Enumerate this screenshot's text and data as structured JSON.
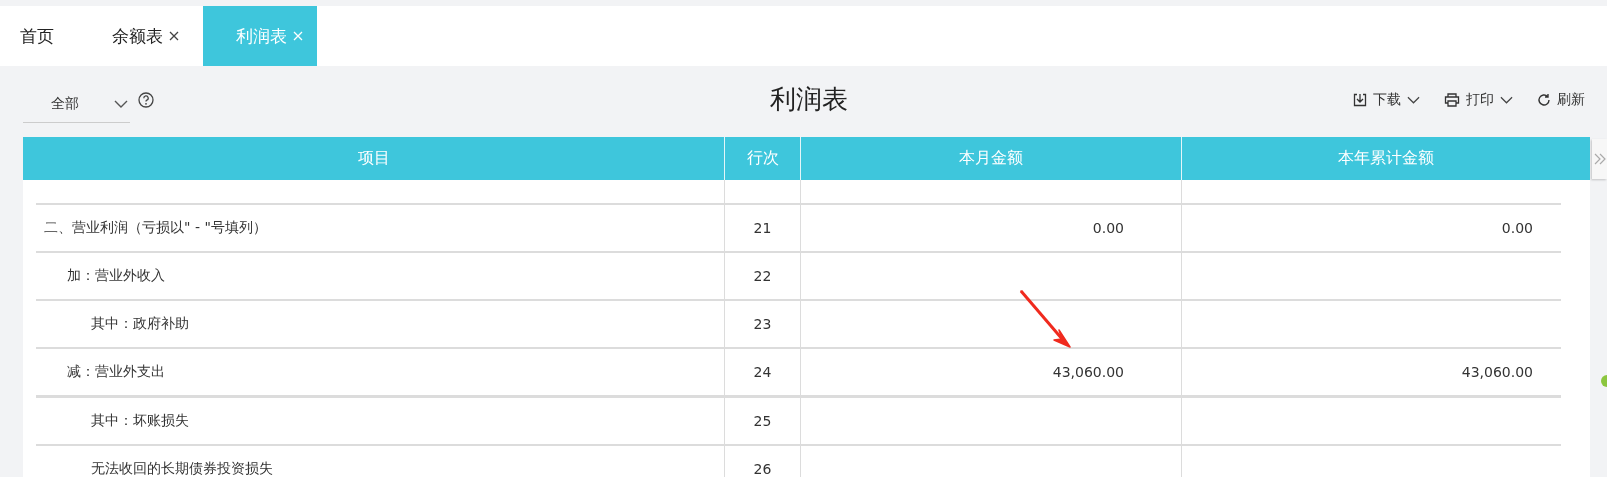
{
  "tabs": [
    {
      "label": "首页",
      "closable": false,
      "selected": false
    },
    {
      "label": "余额表",
      "closable": true,
      "selected": false
    },
    {
      "label": "利润表",
      "closable": true,
      "selected": true
    }
  ],
  "filter": {
    "value": "全部"
  },
  "title": "利润表",
  "toolbar": [
    {
      "label": "下载",
      "kind": "download"
    },
    {
      "label": "打印",
      "kind": "print"
    },
    {
      "label": "刷新",
      "kind": "refresh"
    }
  ],
  "table": {
    "columns": [
      "项目",
      "行次",
      "本月金额",
      "本年累计金额"
    ],
    "rows": [
      {
        "thick_rule": false
      },
      {
        "item": "二、营业利润（亏损以\" - \"号填列）",
        "line": "21",
        "month": "0.00",
        "year": "0.00",
        "kind": "heading",
        "thick_rule": false
      },
      {
        "item": "加：营业外收入",
        "line": "22",
        "month": "",
        "year": "",
        "kind": "item",
        "thick_rule": false
      },
      {
        "item": "其中：政府补助",
        "line": "23",
        "month": "",
        "year": "",
        "kind": "detail",
        "thick_rule": false
      },
      {
        "item": "减：营业外支出",
        "line": "24",
        "month": "43,060.00",
        "year": "43,060.00",
        "kind": "item",
        "thick_rule": true
      },
      {
        "item": "其中：坏账损失",
        "line": "25",
        "month": "",
        "year": "",
        "kind": "detail",
        "thick_rule": false
      },
      {
        "item": "无法收回的长期债券投资损失",
        "line": "26",
        "month": "",
        "year": "",
        "kind": "detail",
        "thick_rule": false
      }
    ]
  }
}
